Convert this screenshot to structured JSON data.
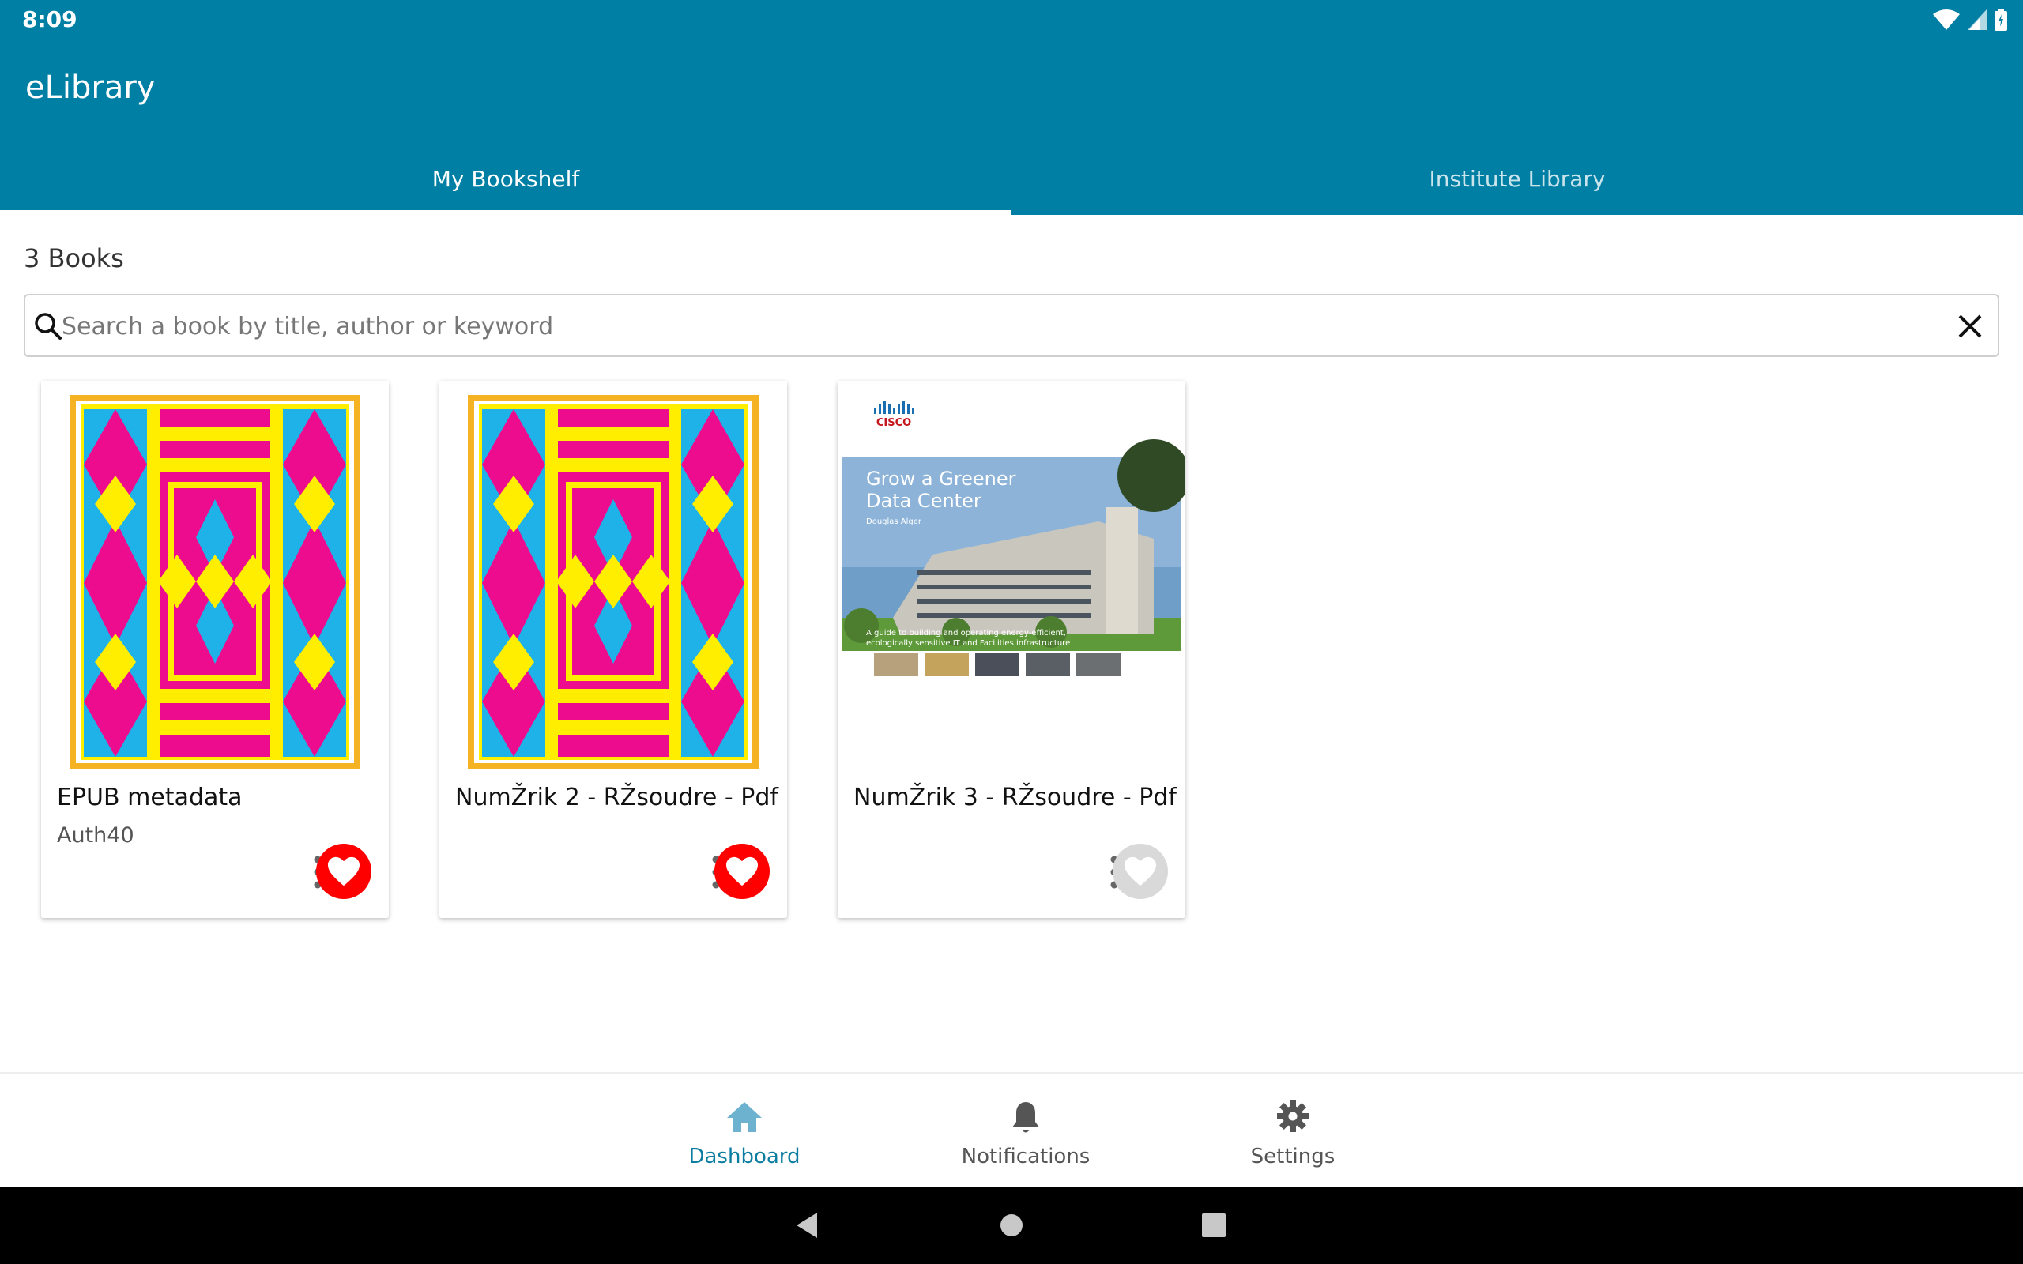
{
  "status_bar": {
    "time": "8:09"
  },
  "app": {
    "title": "eLibrary"
  },
  "tabs": [
    {
      "label": "My Bookshelf",
      "active": true
    },
    {
      "label": "Institute Library",
      "active": false
    }
  ],
  "library": {
    "count_label": "3 Books",
    "search": {
      "placeholder": "Search a book by title, author or keyword",
      "value": ""
    }
  },
  "books": [
    {
      "title": "EPUB metadata",
      "author": "Auth40",
      "favorite": true
    },
    {
      "title": "NumŽrik 2 - RŽsoudre - Pdf",
      "author": "",
      "favorite": true
    },
    {
      "title": "NumŽrik 3 - RŽsoudre - Pdf",
      "author": "",
      "favorite": false,
      "cover_text": {
        "brand": "CISCO",
        "title_line1": "Grow a Greener",
        "title_line2": "Data Center",
        "author": "Douglas Alger",
        "tagline1": "A guide to building and operating energy-efficient,",
        "tagline2": "ecologically sensitive IT and Facilities infrastructure"
      }
    }
  ],
  "bottom_nav": [
    {
      "label": "Dashboard",
      "icon": "home-icon",
      "active": true
    },
    {
      "label": "Notifications",
      "icon": "bell-icon",
      "active": false
    },
    {
      "label": "Settings",
      "icon": "gear-icon",
      "active": false
    }
  ],
  "colors": {
    "primary": "#007fa4",
    "favorite_on": "#ff0000",
    "favorite_off": "#d9d9d9",
    "nav_active": "#0b7da0"
  }
}
